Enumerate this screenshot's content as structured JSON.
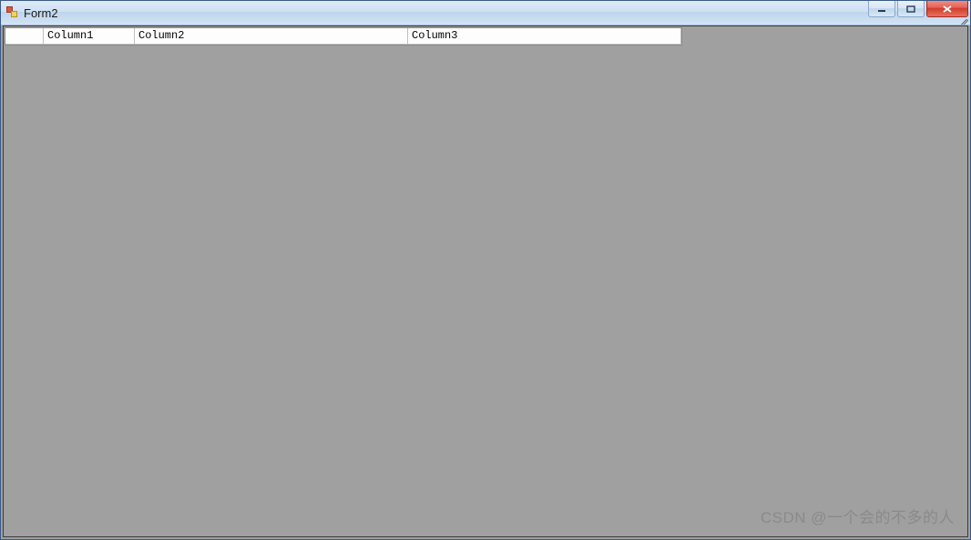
{
  "window": {
    "title": "Form2"
  },
  "datagrid": {
    "columns": [
      {
        "header": "Column1"
      },
      {
        "header": "Column2"
      },
      {
        "header": "Column3"
      }
    ]
  },
  "watermark": "CSDN @一个会的不多的人"
}
